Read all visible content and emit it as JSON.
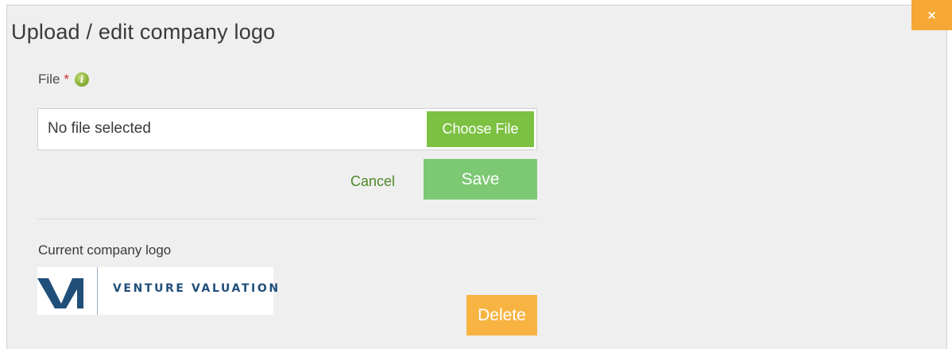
{
  "dialog": {
    "title": "Upload / edit company logo",
    "close_label": "×"
  },
  "file_field": {
    "label": "File",
    "required_mark": "*",
    "info_icon": "info-icon",
    "info_glyph": "i",
    "status_text": "No file selected",
    "choose_label": "Choose File"
  },
  "actions": {
    "cancel_label": "Cancel",
    "save_label": "Save"
  },
  "current_logo": {
    "label": "Current company logo",
    "logo_text": "VENTURE VALUATION",
    "delete_label": "Delete"
  },
  "colors": {
    "dialog_background": "#efefef",
    "close_button": "#f5a833",
    "choose_button": "#7cc142",
    "save_button": "#7dc873",
    "delete_button": "#f7b443",
    "cancel_link": "#4d8a2a",
    "logo_brand": "#1f4e79"
  }
}
